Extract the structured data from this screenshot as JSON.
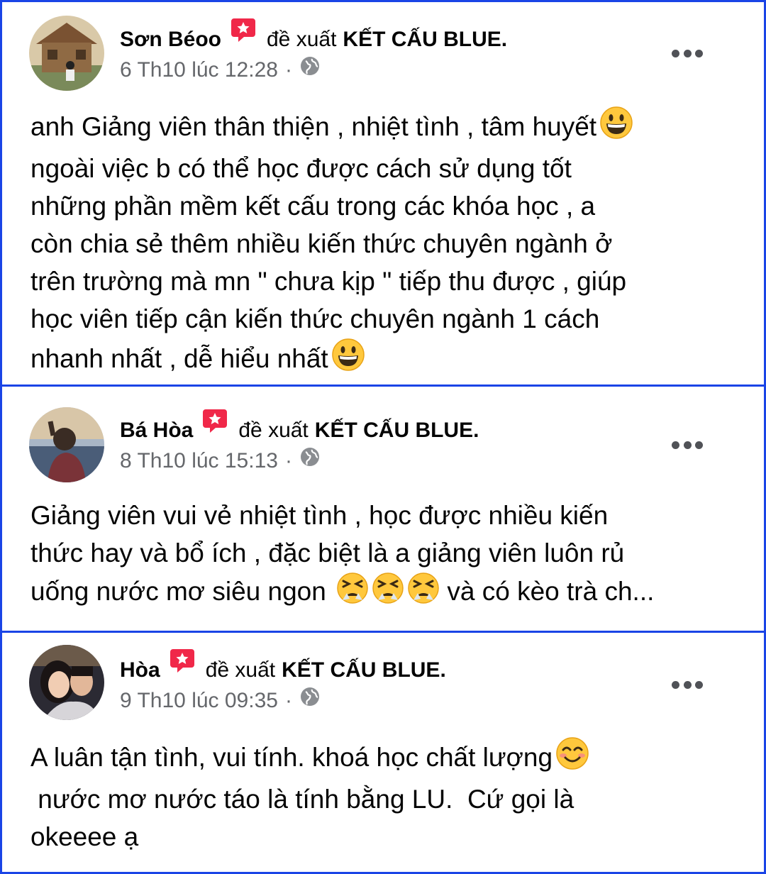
{
  "posts": [
    {
      "author": "Sơn Béoo",
      "verb": "đề xuất",
      "page": "KẾT CẤU BLUE.",
      "time": "6 Th10 lúc 12:28",
      "separator": "·",
      "audience_icon": "globe-icon",
      "recommend_icon": "recommend-star-icon",
      "more_icon": "more-options-icon",
      "lines": [
        "anh Giảng viên thân thiện , nhiệt tình , tâm huyết",
        "ngoài việc b có thể học được cách sử dụng tốt",
        "những phần mềm kết cấu trong các khóa học ,  a",
        "còn chia sẻ thêm nhiều kiến thức chuyên ngành ở",
        "trên trường  mà mn \" chưa kịp \" tiếp thu được ,  giúp",
        "học viên tiếp cận kiến thức chuyên ngành 1 cách",
        "nhanh nhất , dễ hiểu nhất"
      ]
    },
    {
      "author": "Bá Hòa",
      "verb": "đề xuất",
      "page": "KẾT CẤU BLUE.",
      "time": "8 Th10 lúc 15:13",
      "separator": "·",
      "audience_icon": "globe-icon",
      "recommend_icon": "recommend-star-icon",
      "more_icon": "more-options-icon",
      "lines": [
        "Giảng viên vui vẻ nhiệt tình , học được nhiều kiến",
        "thức hay và bổ ích , đặc biệt là a giảng viên luôn rủ",
        "uống nước mơ siêu ngon",
        "và có kèo trà ch..."
      ]
    },
    {
      "author": "Hòa",
      "verb": "đề xuất",
      "page": "KẾT CẤU BLUE.",
      "time": "9 Th10 lúc 09:35",
      "separator": "·",
      "audience_icon": "globe-icon",
      "recommend_icon": "recommend-star-icon",
      "more_icon": "more-options-icon",
      "lines": [
        "A luân tận tình,  vui tính.  khoá học chất lượng",
        " nước mơ nước táo là tính bằng LU.  Cứ gọi là",
        "okeeee ạ"
      ]
    }
  ],
  "colors": {
    "card_border": "#1a44e6",
    "recommend": "#f02849",
    "meta_text": "#65676b",
    "text": "#050505"
  }
}
